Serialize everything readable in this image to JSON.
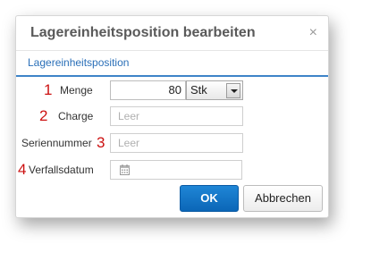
{
  "dialog": {
    "title": "Lagereinheitsposition bearbeiten",
    "close_glyph": "×"
  },
  "tabs": [
    {
      "label": "Lagereinheitsposition",
      "active": true
    }
  ],
  "form": {
    "menge": {
      "num": "1",
      "label": "Menge",
      "value": "80",
      "unit": "Stk"
    },
    "charge": {
      "num": "2",
      "label": "Charge",
      "placeholder": "Leer"
    },
    "seriennummer": {
      "num": "3",
      "label": "Seriennummer",
      "placeholder": "Leer"
    },
    "verfallsdatum": {
      "num": "4",
      "label": "Verfallsdatum",
      "icon": "calendar-icon"
    }
  },
  "buttons": {
    "ok": "OK",
    "cancel": "Abbrechen"
  },
  "colors": {
    "accent": "#1f86d6",
    "tab_text": "#2a6fb8",
    "annotation_red": "#cc1111"
  }
}
